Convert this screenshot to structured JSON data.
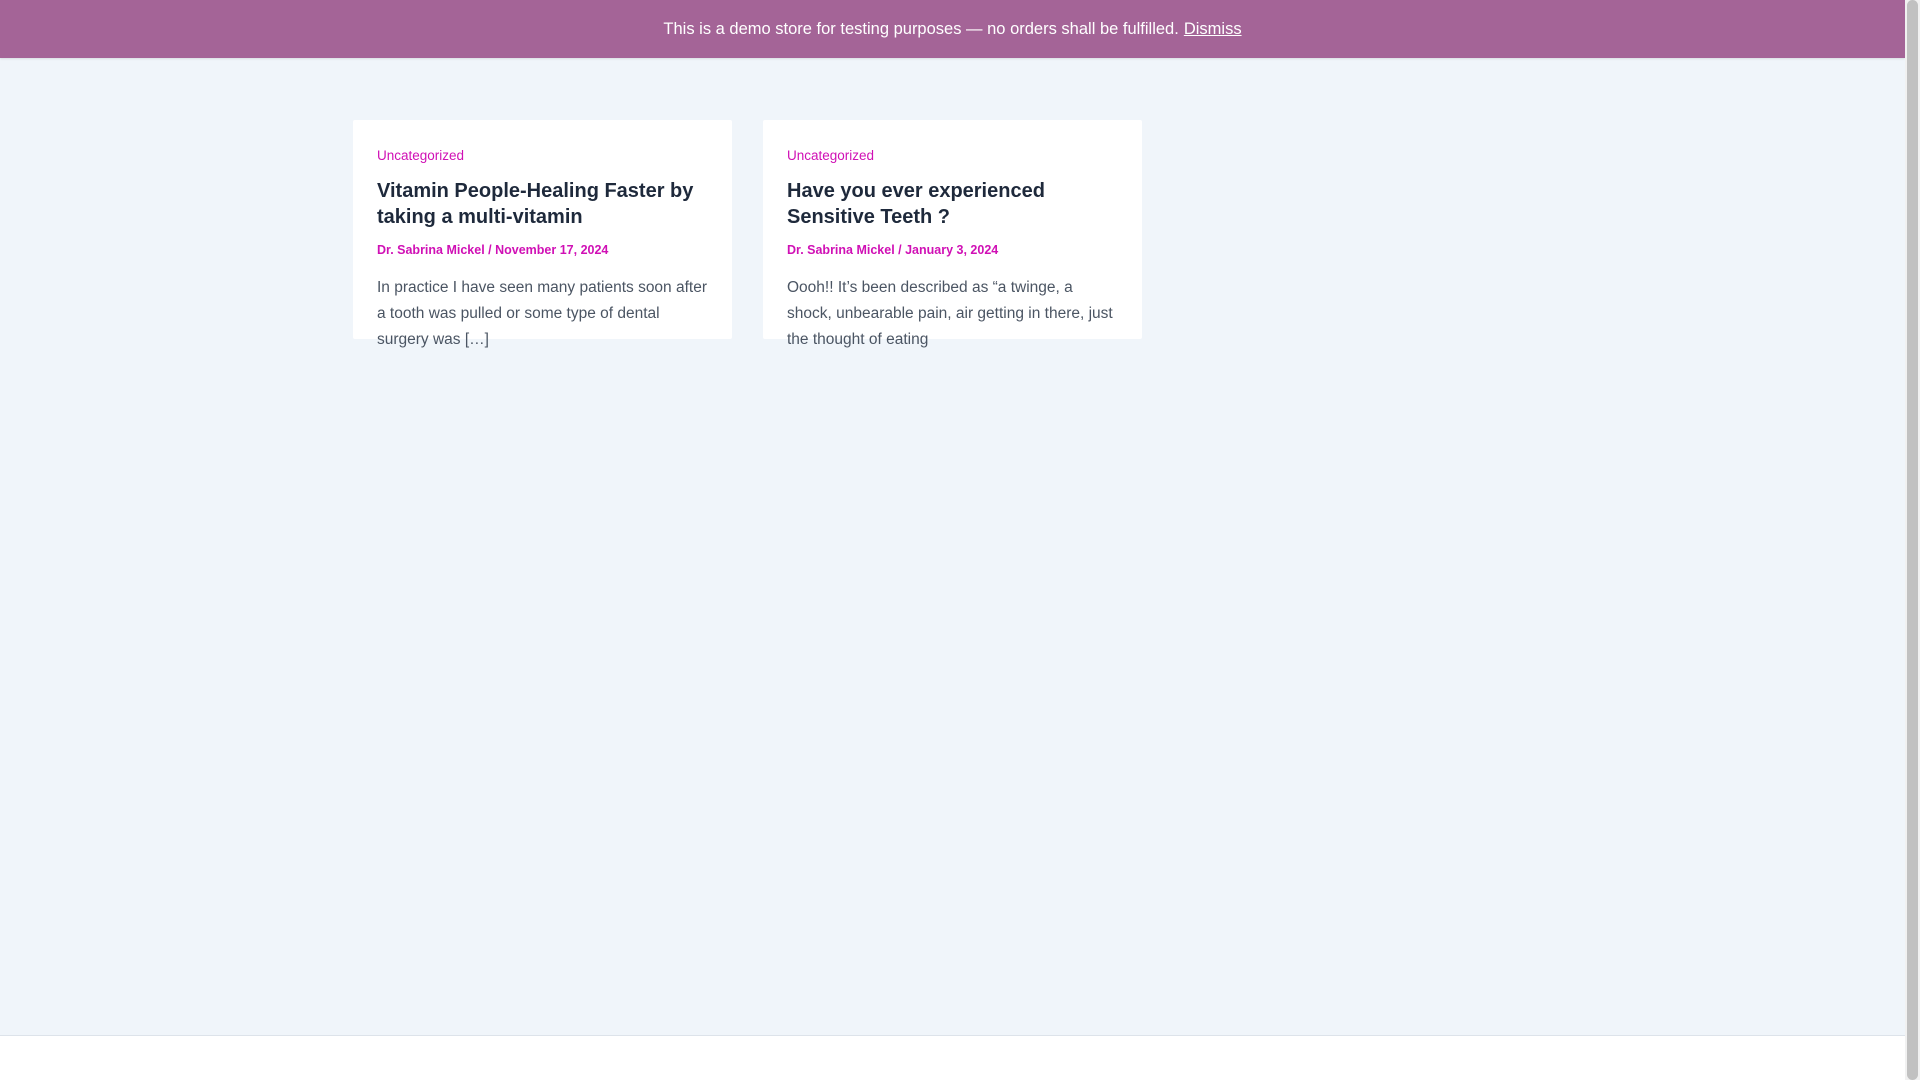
{
  "notice": {
    "text": "This is a demo store for testing purposes — no orders shall be fulfilled.",
    "dismiss_label": "Dismiss"
  },
  "posts": [
    {
      "category": "Uncategorized",
      "title": "Vitamin People-Healing Faster by taking a multi-vitamin",
      "author": "Dr. Sabrina Mickel",
      "separator": " / ",
      "date": "November 17, 2024",
      "excerpt": "In practice I have seen many patients soon after a tooth was pulled or some type of dental surgery was […]"
    },
    {
      "category": "Uncategorized",
      "title": "Have you ever experienced Sensitive Teeth ?",
      "author": "Dr. Sabrina Mickel",
      "separator": " / ",
      "date": "January 3, 2024",
      "excerpt": "Oooh!! It’s been described as “a twinge, a shock, unbearable pain, air getting in there, just the thought of eating"
    }
  ],
  "colors": {
    "notice_bg": "#a46497",
    "accent": "#d010b5",
    "page_bg": "#f0f5fa"
  }
}
